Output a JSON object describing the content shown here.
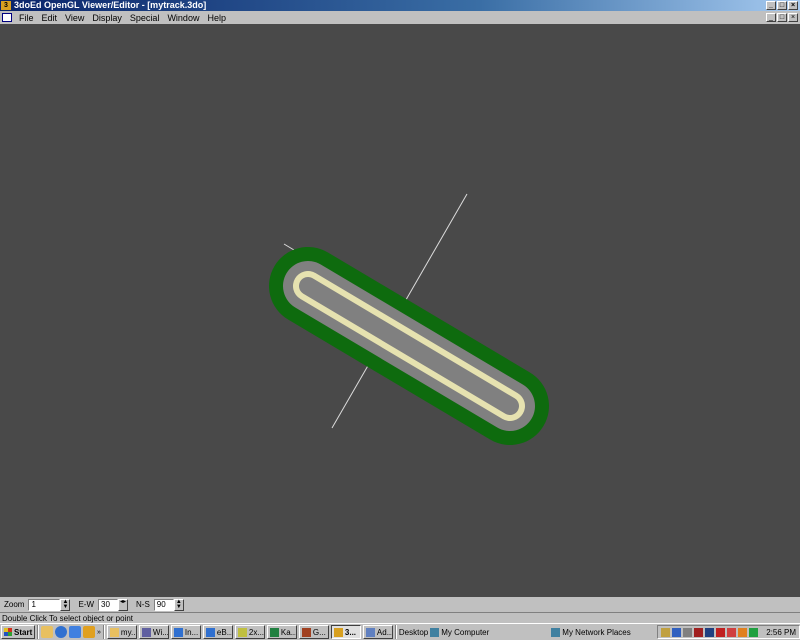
{
  "window": {
    "title": "3doEd OpenGL Viewer/Editor - [mytrack.3do]",
    "icon_label": "3"
  },
  "menu": [
    "File",
    "Edit",
    "View",
    "Display",
    "Special",
    "Window",
    "Help"
  ],
  "toolbar": {
    "zoom_label": "Zoom",
    "zoom_value": "1",
    "ew_label": "E-W",
    "ew_value": "30",
    "ns_label": "N-S",
    "ns_value": "90"
  },
  "status": "Double Click To select object or point",
  "taskbar": {
    "start_label": "Start",
    "tasks": [
      "my...",
      "Wi...",
      "In...",
      "eB...",
      "2x...",
      "Ka...",
      "G...",
      "3...",
      "Ad..."
    ],
    "desktop_label": "Desktop",
    "mycomputer_label": "My Computer",
    "network_label": "My Network Places",
    "clock": "2:56 PM"
  },
  "colors": {
    "viewport_bg": "#494949",
    "grass": "#0e6b0e",
    "track": "#808080",
    "line": "#e6e2b0"
  }
}
